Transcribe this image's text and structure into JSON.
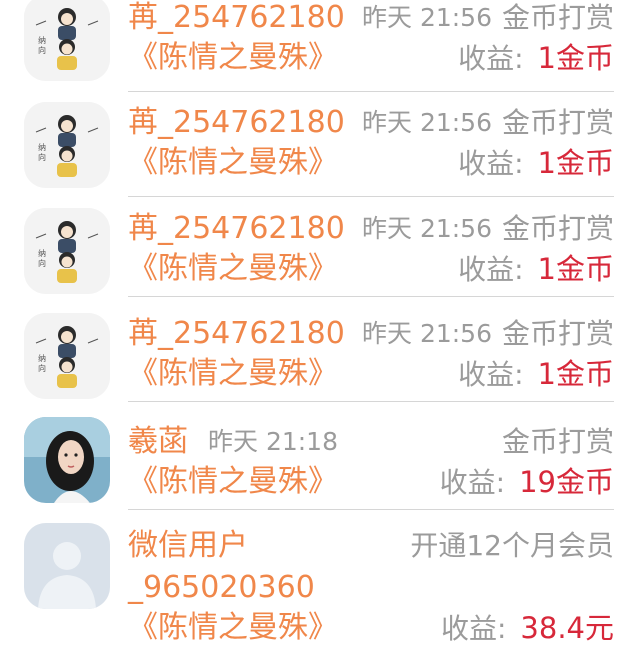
{
  "records": [
    {
      "user": "苒_254762180",
      "time": "昨天 21:56",
      "type": "金币打赏",
      "book": "《陈情之曼殊》",
      "income_label": "收益:",
      "income_value": "1金币"
    },
    {
      "user": "苒_254762180",
      "time": "昨天 21:56",
      "type": "金币打赏",
      "book": "《陈情之曼殊》",
      "income_label": "收益:",
      "income_value": "1金币"
    },
    {
      "user": "苒_254762180",
      "time": "昨天 21:56",
      "type": "金币打赏",
      "book": "《陈情之曼殊》",
      "income_label": "收益:",
      "income_value": "1金币"
    },
    {
      "user": "苒_254762180",
      "time": "昨天 21:56",
      "type": "金币打赏",
      "book": "《陈情之曼殊》",
      "income_label": "收益:",
      "income_value": "1金币"
    },
    {
      "user": "羲菡",
      "time": "昨天 21:18",
      "type": "金币打赏",
      "book": "《陈情之曼殊》",
      "income_label": "收益:",
      "income_value": "19金币"
    },
    {
      "user_line1": "微信用户",
      "user_line2": "_965020360",
      "type": "开通12个月会员",
      "book": "《陈情之曼殊》",
      "income_label": "收益:",
      "income_value": "38.4元"
    }
  ],
  "icons": {
    "cartoon_avatar": "cartoon-avatar-icon",
    "photo_avatar": "photo-avatar-icon",
    "default_avatar": "default-user-avatar-icon"
  },
  "colors": {
    "username": "#f0874a",
    "muted": "#9b9b9b",
    "income": "#d7283a",
    "divider": "#d6d6d6"
  }
}
